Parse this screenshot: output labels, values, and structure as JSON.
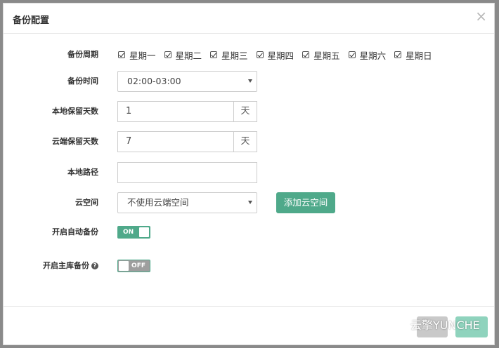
{
  "dialog": {
    "title": "备份配置",
    "close_glyph": "×"
  },
  "backup_cycle": {
    "label": "备份周期",
    "days": [
      {
        "label": "星期一",
        "checked": true
      },
      {
        "label": "星期二",
        "checked": true
      },
      {
        "label": "星期三",
        "checked": true
      },
      {
        "label": "星期四",
        "checked": true
      },
      {
        "label": "星期五",
        "checked": true
      },
      {
        "label": "星期六",
        "checked": true
      },
      {
        "label": "星期日",
        "checked": true
      }
    ]
  },
  "backup_time": {
    "label": "备份时间",
    "value": "02:00-03:00"
  },
  "local_retention": {
    "label": "本地保留天数",
    "value": "1",
    "unit": "天"
  },
  "cloud_retention": {
    "label": "云端保留天数",
    "value": "7",
    "unit": "天"
  },
  "local_path": {
    "label": "本地路径",
    "value": ""
  },
  "cloud_space": {
    "label": "云空间",
    "value": "不使用云端空间",
    "add_button": "添加云空间"
  },
  "auto_backup": {
    "label": "开启自动备份",
    "state": "ON"
  },
  "main_db_backup": {
    "label": "开启主库备份",
    "help_glyph": "?",
    "state": "OFF"
  },
  "watermark": {
    "text": "云擎YUNCHE"
  },
  "colors": {
    "accent": "#4fa98a",
    "accent_light": "#8fd3bd",
    "toggle_off": "#9e9e9e"
  }
}
